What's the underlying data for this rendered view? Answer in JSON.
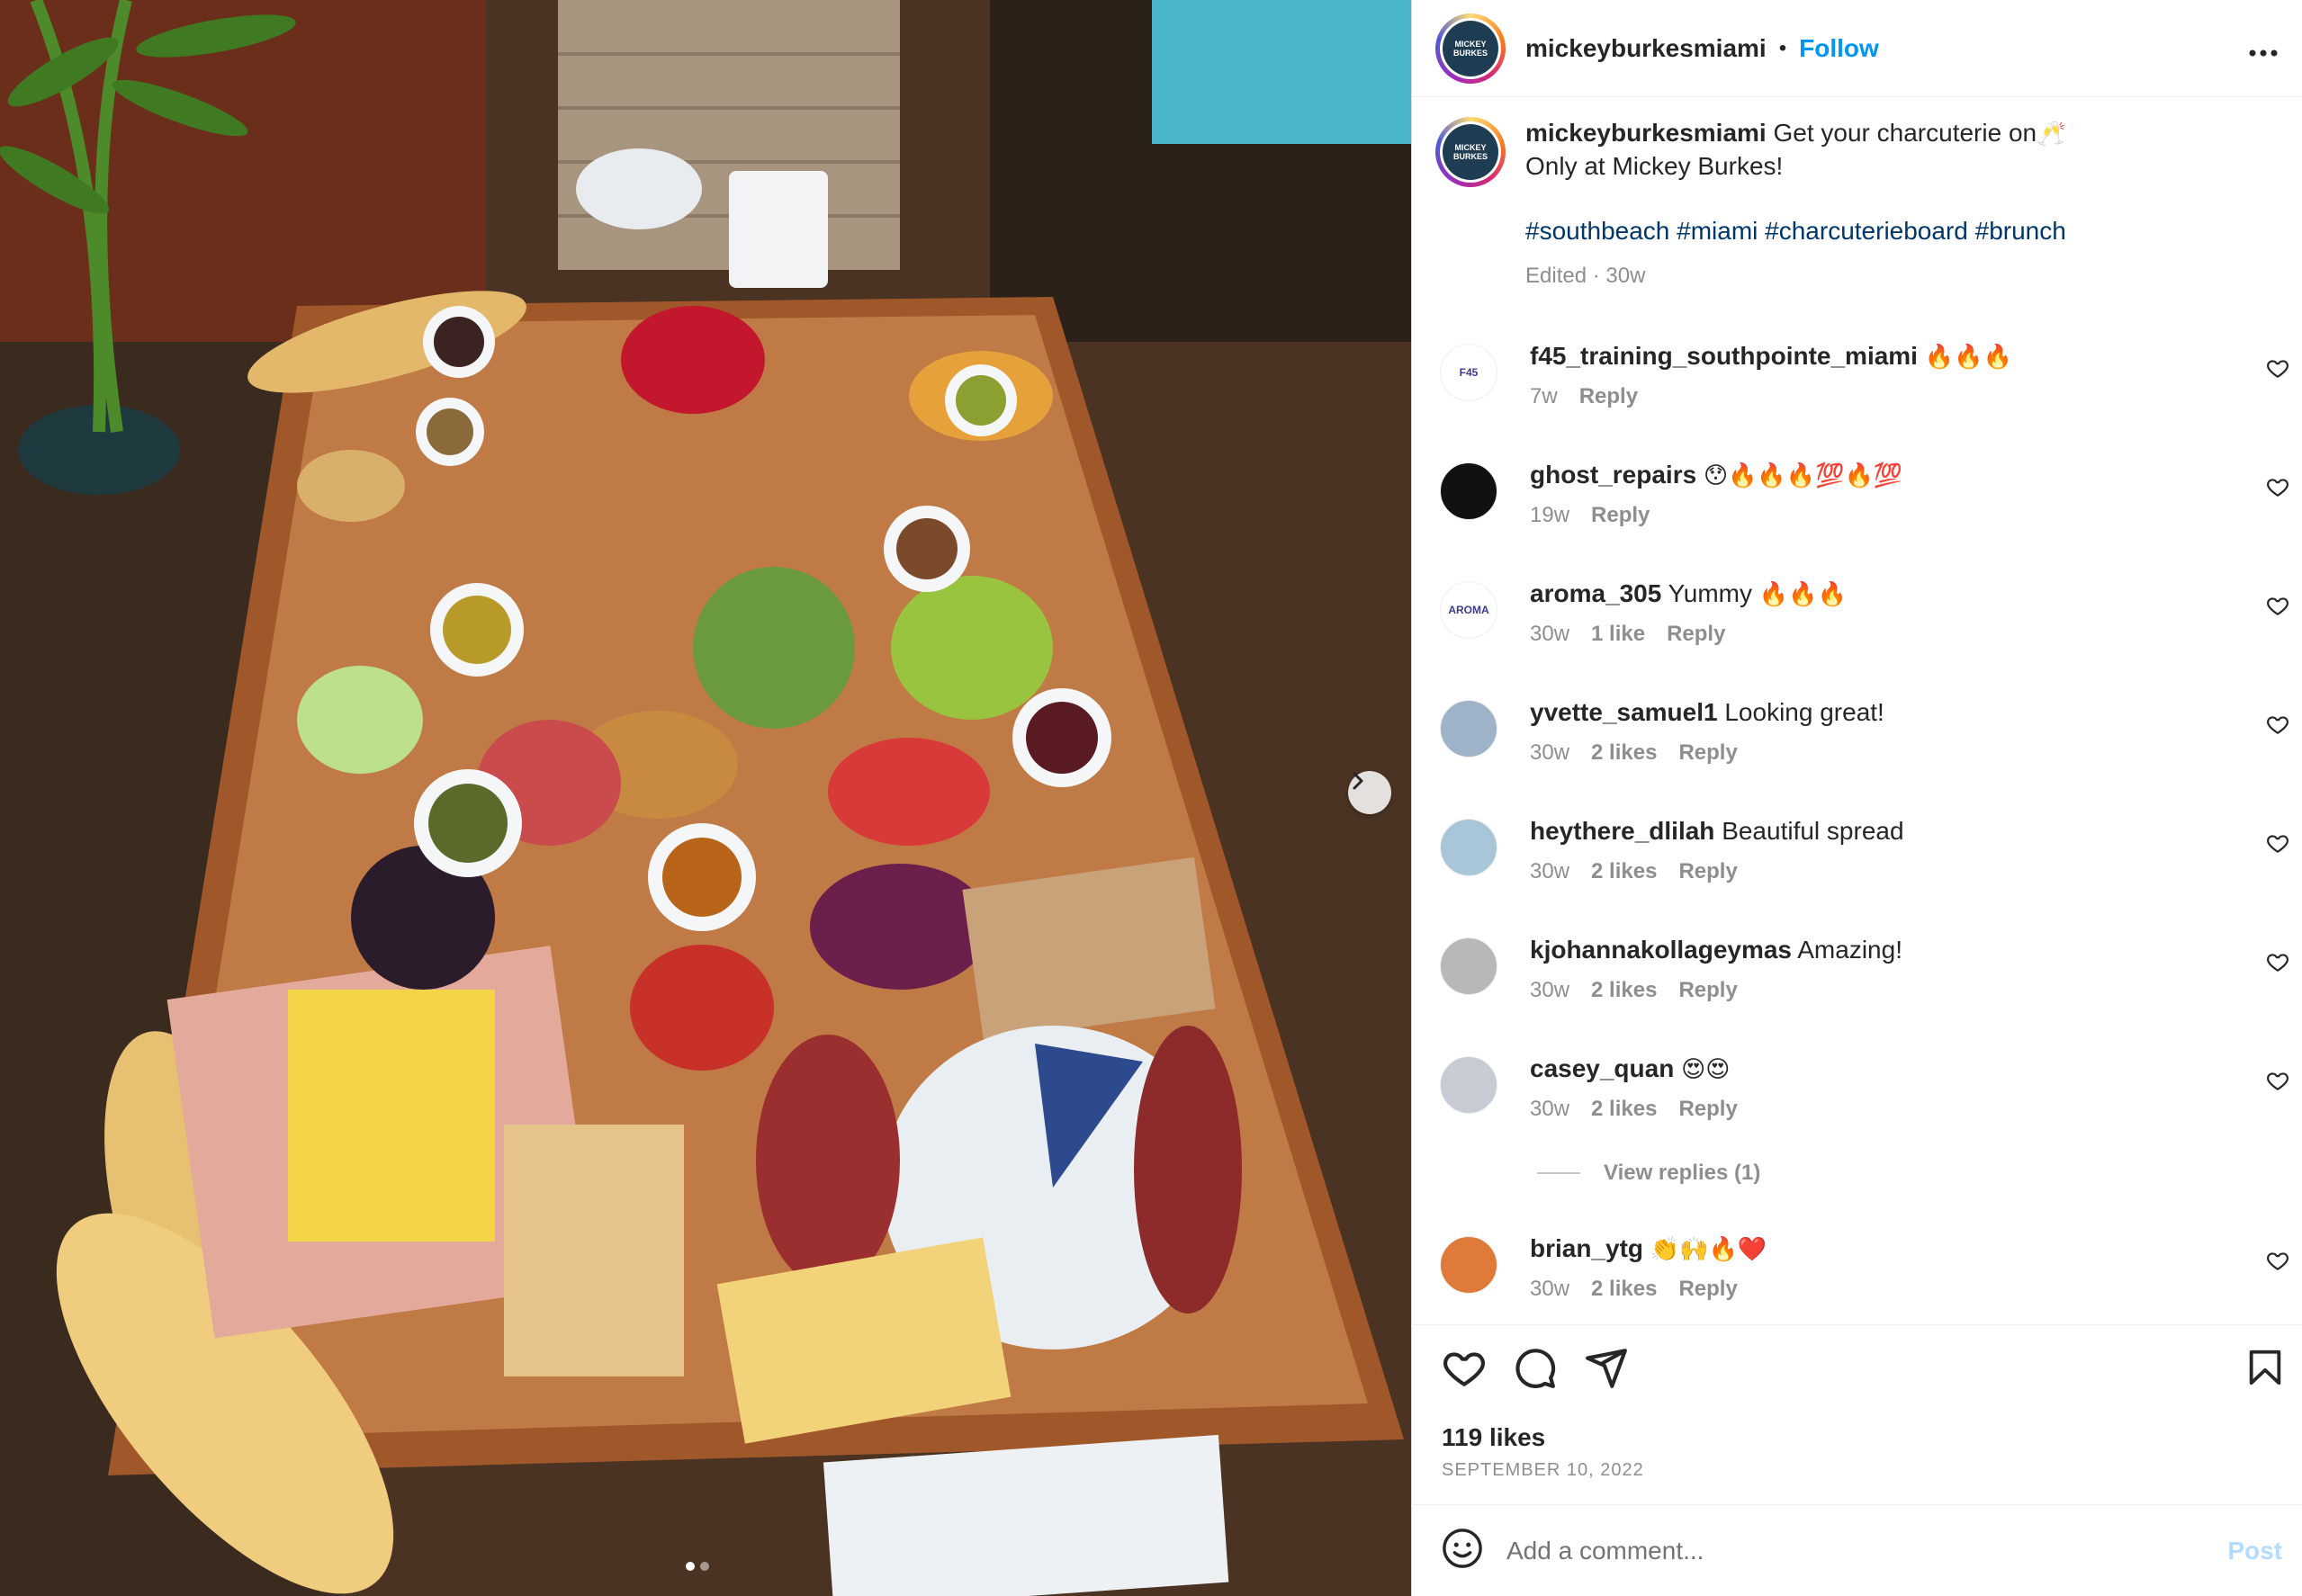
{
  "post": {
    "username": "mickeyburkesmiami",
    "follow_label": "Follow",
    "separator": "•",
    "avatar_text": "MICKEY BURKES",
    "more_icon": "more-horizontal-icon"
  },
  "caption": {
    "username": "mickeyburkesmiami",
    "line1": "Get your charcuterie on",
    "line1_emoji": "🥂",
    "line2": "Only at Mickey Burkes!",
    "hashtags": "#southbeach #miami #charcuterieboard #brunch",
    "meta": "Edited · 30w"
  },
  "comments": [
    {
      "username": "f45_training_southpointe_miami",
      "text": "",
      "emoji": "🔥🔥🔥",
      "time": "7w",
      "likes": "",
      "reply": "Reply",
      "avatar_color": "#ffffff",
      "avatar_label": "F45"
    },
    {
      "username": "ghost_repairs",
      "text": "",
      "emoji": "😯🔥🔥🔥💯🔥💯",
      "time": "19w",
      "likes": "",
      "reply": "Reply",
      "avatar_color": "#111111",
      "avatar_label": ""
    },
    {
      "username": "aroma_305",
      "text": "Yummy",
      "emoji": "🔥🔥🔥",
      "time": "30w",
      "likes": "1 like",
      "reply": "Reply",
      "avatar_color": "#ffffff",
      "avatar_label": "AROMA"
    },
    {
      "username": "yvette_samuel1",
      "text": "Looking great!",
      "emoji": "",
      "time": "30w",
      "likes": "2 likes",
      "reply": "Reply",
      "avatar_color": "#9fb3c8",
      "avatar_label": ""
    },
    {
      "username": "heythere_dlilah",
      "text": "Beautiful spread",
      "emoji": "",
      "time": "30w",
      "likes": "2 likes",
      "reply": "Reply",
      "avatar_color": "#a9c6d8",
      "avatar_label": ""
    },
    {
      "username": "kjohannakollageymas",
      "text": "Amazing!",
      "emoji": "",
      "time": "30w",
      "likes": "2 likes",
      "reply": "Reply",
      "avatar_color": "#b8b8b8",
      "avatar_label": ""
    },
    {
      "username": "casey_quan",
      "text": "",
      "emoji": "😍😍",
      "time": "30w",
      "likes": "2 likes",
      "reply": "Reply",
      "avatar_color": "#c7ccd4",
      "avatar_label": ""
    },
    {
      "username": "brian_ytg",
      "text": "",
      "emoji": "👏🙌🔥❤️",
      "time": "30w",
      "likes": "2 likes",
      "reply": "Reply",
      "avatar_color": "#e07a3a",
      "avatar_label": ""
    }
  ],
  "view_replies": "View replies (1)",
  "actions": {
    "like_icon": "heart-icon",
    "comment_icon": "comment-icon",
    "share_icon": "share-icon",
    "save_icon": "bookmark-icon"
  },
  "likes_count": "119 likes",
  "date": "SEPTEMBER 10, 2022",
  "comment_box": {
    "placeholder": "Add a comment...",
    "post_label": "Post",
    "emoji_icon": "emoji-icon"
  },
  "carousel": {
    "current": 1,
    "total": 2,
    "next_icon": "chevron-right-icon"
  },
  "colors": {
    "accent": "#0095f6",
    "hashtag": "#00376b",
    "muted": "#8e8e8e",
    "post_disabled": "#b3dbff"
  }
}
